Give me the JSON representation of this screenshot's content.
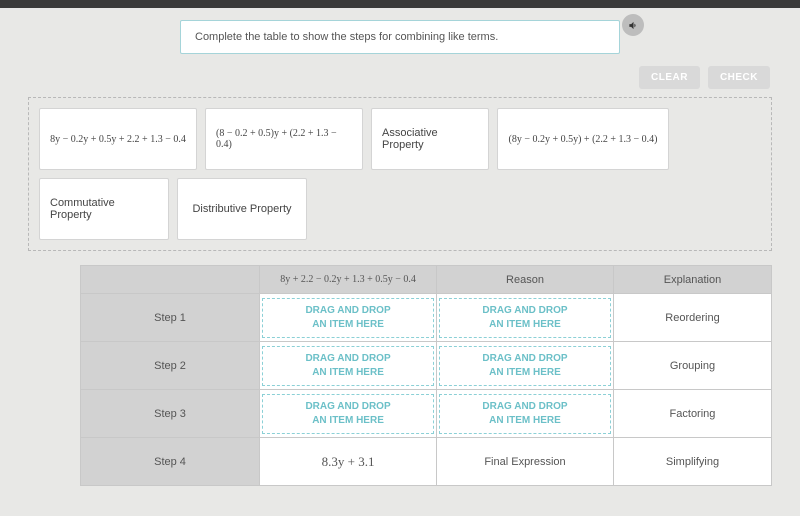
{
  "prompt": "Complete the table to show the steps for combining like terms.",
  "buttons": {
    "clear": "CLEAR",
    "check": "CHECK"
  },
  "tiles": [
    "8y − 0.2y + 0.5y + 2.2 + 1.3 − 0.4",
    "(8 − 0.2 + 0.5)y + (2.2 + 1.3 − 0.4)",
    "Associative Property",
    "(8y − 0.2y + 0.5y) + (2.2 + 1.3 − 0.4)",
    "Commutative Property",
    "Distributive Property"
  ],
  "table": {
    "header_expr": "8y + 2.2 − 0.2y + 1.3 + 0.5y − 0.4",
    "header_reason": "Reason",
    "header_explanation": "Explanation",
    "dropzone_l1": "DRAG AND DROP",
    "dropzone_l2": "AN ITEM HERE",
    "steps": [
      {
        "label": "Step 1",
        "explanation": "Reordering"
      },
      {
        "label": "Step 2",
        "explanation": "Grouping"
      },
      {
        "label": "Step 3",
        "explanation": "Factoring"
      },
      {
        "label": "Step 4",
        "expr": "8.3y + 3.1",
        "reason": "Final Expression",
        "explanation": "Simplifying"
      }
    ]
  }
}
